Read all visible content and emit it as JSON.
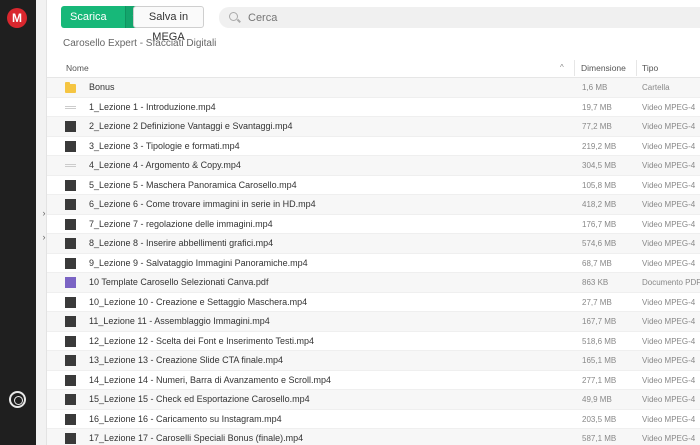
{
  "app": {
    "logo_letter": "M"
  },
  "toolbar": {
    "download_label": "Scarica",
    "download_arrow": "▾",
    "save_label": "Salva in MEGA",
    "search_placeholder": "Cerca"
  },
  "breadcrumb": "Carosello Expert - Sfacciati Digitali",
  "table": {
    "headers": {
      "name": "Nome",
      "size": "Dimensione",
      "type": "Tipo",
      "sort_indicator": "^"
    },
    "rows": [
      {
        "name": "Bonus",
        "size": "1,6 MB",
        "type": "Cartella",
        "icon": "folder-icon"
      },
      {
        "name": "1_Lezione 1 - Introduzione.mp4",
        "size": "19,7 MB",
        "type": "Video MPEG-4",
        "icon": "video-thumb"
      },
      {
        "name": "2_Lezione 2 Definizione Vantaggi e Svantaggi.mp4",
        "size": "77,2 MB",
        "type": "Video MPEG-4",
        "icon": "video-thumb"
      },
      {
        "name": "3_Lezione 3 - Tipologie e formati.mp4",
        "size": "219,2 MB",
        "type": "Video MPEG-4",
        "icon": "video-thumb"
      },
      {
        "name": "4_Lezione 4 - Argomento & Copy.mp4",
        "size": "304,5 MB",
        "type": "Video MPEG-4",
        "icon": "video-thumb"
      },
      {
        "name": "5_Lezione 5 - Maschera Panoramica Carosello.mp4",
        "size": "105,8 MB",
        "type": "Video MPEG-4",
        "icon": "video-thumb"
      },
      {
        "name": "6_Lezione 6 - Come trovare immagini in serie in HD.mp4",
        "size": "418,2 MB",
        "type": "Video MPEG-4",
        "icon": "video-thumb"
      },
      {
        "name": "7_Lezione 7 - regolazione delle immagini.mp4",
        "size": "176,7 MB",
        "type": "Video MPEG-4",
        "icon": "video-thumb"
      },
      {
        "name": "8_Lezione 8 - Inserire abbellimenti grafici.mp4",
        "size": "574,6 MB",
        "type": "Video MPEG-4",
        "icon": "video-thumb"
      },
      {
        "name": "9_Lezione 9 - Salvataggio Immagini Panoramiche.mp4",
        "size": "68,7 MB",
        "type": "Video MPEG-4",
        "icon": "video-thumb"
      },
      {
        "name": "10 Template Carosello Selezionati Canva.pdf",
        "size": "863 KB",
        "type": "Documento PDF",
        "icon": "pdf-thumb"
      },
      {
        "name": "10_Lezione 10 - Creazione e Settaggio Maschera.mp4",
        "size": "27,7 MB",
        "type": "Video MPEG-4",
        "icon": "video-thumb"
      },
      {
        "name": "11_Lezione 11 - Assemblaggio Immagini.mp4",
        "size": "167,7 MB",
        "type": "Video MPEG-4",
        "icon": "video-thumb"
      },
      {
        "name": "12_Lezione 12 - Scelta dei Font e Inserimento Testi.mp4",
        "size": "518,6 MB",
        "type": "Video MPEG-4",
        "icon": "video-thumb"
      },
      {
        "name": "13_Lezione 13 - Creazione Slide CTA finale.mp4",
        "size": "165,1 MB",
        "type": "Video MPEG-4",
        "icon": "video-thumb"
      },
      {
        "name": "14_Lezione 14 - Numeri, Barra di Avanzamento e Scroll.mp4",
        "size": "277,1 MB",
        "type": "Video MPEG-4",
        "icon": "video-thumb"
      },
      {
        "name": "15_Lezione 15 - Check ed Esportazione Carosello.mp4",
        "size": "49,9 MB",
        "type": "Video MPEG-4",
        "icon": "video-thumb"
      },
      {
        "name": "16_Lezione 16 - Caricamento su Instagram.mp4",
        "size": "203,5 MB",
        "type": "Video MPEG-4",
        "icon": "video-thumb"
      },
      {
        "name": "17_Lezione 17 - Caroselli Speciali Bonus (finale).mp4",
        "size": "587,1 MB",
        "type": "Video MPEG-4",
        "icon": "video-thumb"
      }
    ]
  },
  "colors": {
    "accent_green": "#17b879",
    "logo_red": "#d9272e",
    "rail_dark": "#1f1f1f"
  }
}
